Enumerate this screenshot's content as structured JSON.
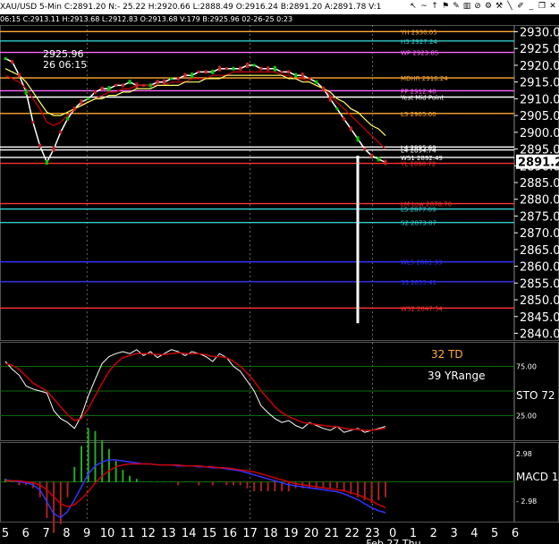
{
  "window": {
    "title": "XAU/USD  5-Min  C:2891.20  N:- 25.22  H:2920.66  L:2888.49  O:2916.24  B:2891.20  A:2891.78  V:1",
    "info": "06:15  C:2913.11  H:2913.68  L:2912.83  O:2913.68  V:179  B:2925.96  02-26-25  0:23",
    "toolbar_icons": [
      "cursor-icon",
      "wave-icon",
      "up-icon",
      "flag-icon",
      "pencil-icon",
      "bars-icon",
      "stop-icon",
      "settings-icon",
      "tool-icon",
      "line-icon",
      "pen-icon",
      "minimize-icon",
      "restore-icon",
      "close-icon"
    ]
  },
  "colors": {
    "background": "#000000",
    "price_white": "#ffffff",
    "ma_red": "#cc0000",
    "ma_yellow": "#ffff66",
    "ma_green": "#009900",
    "cyan": "#33cccc",
    "orange": "#ffaa33",
    "pink": "#ff66ff",
    "blue": "#3333ff",
    "grid_green": "#0a6a0a"
  },
  "chart_data": [
    {
      "type": "line",
      "panel": "price",
      "ylim": [
        2838,
        2932
      ],
      "yticks": [
        "2930.00",
        "2925.00",
        "2920.00",
        "2915.00",
        "2910.00",
        "2905.00",
        "2900.00",
        "2895.00",
        "2890.00",
        "2885.00",
        "2880.00",
        "2875.00",
        "2870.00",
        "2865.00",
        "2860.00",
        "2855.00",
        "2850.00",
        "2845.00",
        "2840.00"
      ],
      "last_price_label": "2891.21",
      "annotations": [
        "2925.96",
        "26 06:15"
      ],
      "levels": [
        {
          "label": "YH 2930.05",
          "value": 2930.05,
          "color": "#ffaa33"
        },
        {
          "label": "H3 2927.24",
          "value": 2927.24,
          "color": "#33cccc"
        },
        {
          "label": "WP 2923.85",
          "value": 2923.85,
          "color": "#ff66ff"
        },
        {
          "label": "MDHR 2916.24",
          "value": 2916.24,
          "color": "#ffaa33"
        },
        {
          "label": "PP 2912.40",
          "value": 2912.4,
          "color": "#ff66ff"
        },
        {
          "label": "Yest Mid Point",
          "value": 2910.5,
          "color": "#ffffff"
        },
        {
          "label": "L3 2905.60",
          "value": 2905.6,
          "color": "#ffaa33"
        },
        {
          "label": "L4 2895.60",
          "value": 2895.6,
          "color": "#ffffff"
        },
        {
          "label": "L4 2894.74",
          "value": 2894.74,
          "color": "#ffffff"
        },
        {
          "label": "WS1 2892.49",
          "value": 2892.49,
          "color": "#ffffff"
        },
        {
          "label": "YL 2890.72",
          "value": 2890.72,
          "color": "#ff3333"
        },
        {
          "label": "LM Low 2878.70",
          "value": 2878.7,
          "color": "#ff3333"
        },
        {
          "label": "L5 2877.09",
          "value": 2877.09,
          "color": "#33cccc"
        },
        {
          "label": "S2 2873.07",
          "value": 2873.07,
          "color": "#33cccc"
        },
        {
          "label": "WL5 2861.33",
          "value": 2861.33,
          "color": "#3333ff"
        },
        {
          "label": "S3 2855.41",
          "value": 2855.41,
          "color": "#3333ff"
        },
        {
          "label": "WS2 2847.54",
          "value": 2847.54,
          "color": "#ff3333"
        }
      ],
      "series": [
        {
          "values": [
            2922,
            2921,
            2917,
            2912,
            2903,
            2896,
            2891,
            2895,
            2900,
            2904,
            2907,
            2909,
            2910,
            2912,
            2913,
            2913,
            2914,
            2914,
            2915,
            2914,
            2914,
            2914,
            2915,
            2915,
            2916,
            2916,
            2917,
            2917,
            2918,
            2918,
            2918,
            2919,
            2919,
            2919,
            2919,
            2920,
            2920,
            2919,
            2919,
            2919,
            2918,
            2918,
            2917,
            2917,
            2916,
            2915,
            2913,
            2910,
            2907,
            2904,
            2901,
            2898,
            2895,
            2893,
            2892,
            2891
          ]
        },
        {
          "values": [
            2917,
            2916,
            2915,
            2913,
            2910,
            2907,
            2903,
            2902,
            2903,
            2905,
            2907,
            2908,
            2909,
            2910,
            2911,
            2912,
            2912,
            2913,
            2913,
            2914,
            2914,
            2914,
            2914,
            2914,
            2915,
            2915,
            2915,
            2916,
            2916,
            2916,
            2917,
            2917,
            2917,
            2918,
            2918,
            2918,
            2918,
            2918,
            2918,
            2918,
            2917,
            2917,
            2916,
            2916,
            2915,
            2914,
            2913,
            2911,
            2909,
            2907,
            2905,
            2903,
            2901,
            2899,
            2897,
            2895
          ]
        },
        {
          "values": [
            2919,
            2918,
            2917,
            2915,
            2912,
            2909,
            2906,
            2905,
            2905,
            2906,
            2907,
            2908,
            2909,
            2910,
            2910,
            2911,
            2911,
            2912,
            2912,
            2913,
            2913,
            2913,
            2914,
            2914,
            2914,
            2914,
            2915,
            2915,
            2915,
            2916,
            2916,
            2916,
            2917,
            2917,
            2917,
            2917,
            2917,
            2917,
            2917,
            2917,
            2917,
            2916,
            2916,
            2915,
            2915,
            2914,
            2913,
            2912,
            2910,
            2909,
            2907,
            2906,
            2904,
            2902,
            2901,
            2899
          ]
        }
      ]
    },
    {
      "type": "line",
      "panel": "stochastic",
      "ylim": [
        0,
        100
      ],
      "yticks": [
        "75.00",
        "25.00"
      ],
      "labels": [
        "32 TD",
        "39 YRange",
        "STO 72"
      ],
      "series": [
        {
          "values": [
            80,
            72,
            66,
            55,
            52,
            50,
            48,
            30,
            22,
            18,
            12,
            25,
            45,
            62,
            78,
            85,
            88,
            90,
            88,
            92,
            86,
            90,
            84,
            88,
            92,
            90,
            86,
            90,
            88,
            85,
            80,
            88,
            84,
            75,
            70,
            60,
            50,
            35,
            28,
            22,
            18,
            20,
            15,
            12,
            18,
            15,
            12,
            10,
            14,
            8,
            10,
            12,
            8,
            10,
            12,
            14
          ]
        },
        {
          "values": [
            78,
            76,
            72,
            65,
            58,
            54,
            50,
            42,
            34,
            26,
            20,
            22,
            32,
            45,
            58,
            70,
            78,
            84,
            86,
            88,
            88,
            88,
            87,
            87,
            88,
            89,
            88,
            88,
            88,
            87,
            85,
            85,
            84,
            80,
            75,
            68,
            60,
            50,
            42,
            34,
            28,
            24,
            21,
            18,
            17,
            16,
            15,
            14,
            14,
            12,
            11,
            11,
            10,
            10,
            11,
            12
          ]
        }
      ]
    },
    {
      "type": "line",
      "panel": "macd",
      "ylim": [
        -4,
        4
      ],
      "yticks": [
        "2.98",
        "- 2.98"
      ],
      "labels": [
        "MACD 1"
      ],
      "series": [
        {
          "values": [
            0.2,
            0.1,
            0.0,
            -0.1,
            -0.3,
            -0.8,
            -2.0,
            -3.2,
            -3.6,
            -3.0,
            -1.8,
            -0.5,
            0.8,
            1.6,
            2.0,
            2.2,
            2.2,
            2.1,
            2.0,
            1.9,
            1.8,
            1.8,
            1.7,
            1.7,
            1.7,
            1.6,
            1.6,
            1.6,
            1.5,
            1.5,
            1.4,
            1.4,
            1.3,
            1.2,
            1.1,
            0.9,
            0.7,
            0.5,
            0.3,
            0.1,
            -0.1,
            -0.3,
            -0.4,
            -0.5,
            -0.6,
            -0.7,
            -0.8,
            -0.9,
            -1.0,
            -1.2,
            -1.5,
            -1.8,
            -2.2,
            -2.6,
            -2.9,
            -3.1
          ]
        },
        {
          "values": [
            0.1,
            0.1,
            0.1,
            0.0,
            -0.1,
            -0.3,
            -0.8,
            -1.5,
            -2.2,
            -2.5,
            -2.3,
            -1.7,
            -1.0,
            -0.1,
            0.6,
            1.1,
            1.5,
            1.7,
            1.8,
            1.8,
            1.8,
            1.8,
            1.7,
            1.7,
            1.7,
            1.7,
            1.6,
            1.6,
            1.6,
            1.5,
            1.5,
            1.4,
            1.4,
            1.3,
            1.2,
            1.1,
            1.0,
            0.8,
            0.6,
            0.4,
            0.2,
            0.0,
            -0.2,
            -0.3,
            -0.4,
            -0.5,
            -0.6,
            -0.7,
            -0.8,
            -0.9,
            -1.1,
            -1.3,
            -1.6,
            -1.9,
            -2.3,
            -2.6
          ]
        }
      ]
    }
  ],
  "x_axis": {
    "labels": [
      "5",
      "6",
      "7",
      "8",
      "9",
      "10",
      "11",
      "12",
      "13",
      "14",
      "15",
      "16",
      "17",
      "18",
      "19",
      "20",
      "21",
      "22",
      "23",
      "0",
      "1",
      "2",
      "3",
      "4",
      "5",
      "6"
    ],
    "date_label": "Feb 27 Thu"
  }
}
